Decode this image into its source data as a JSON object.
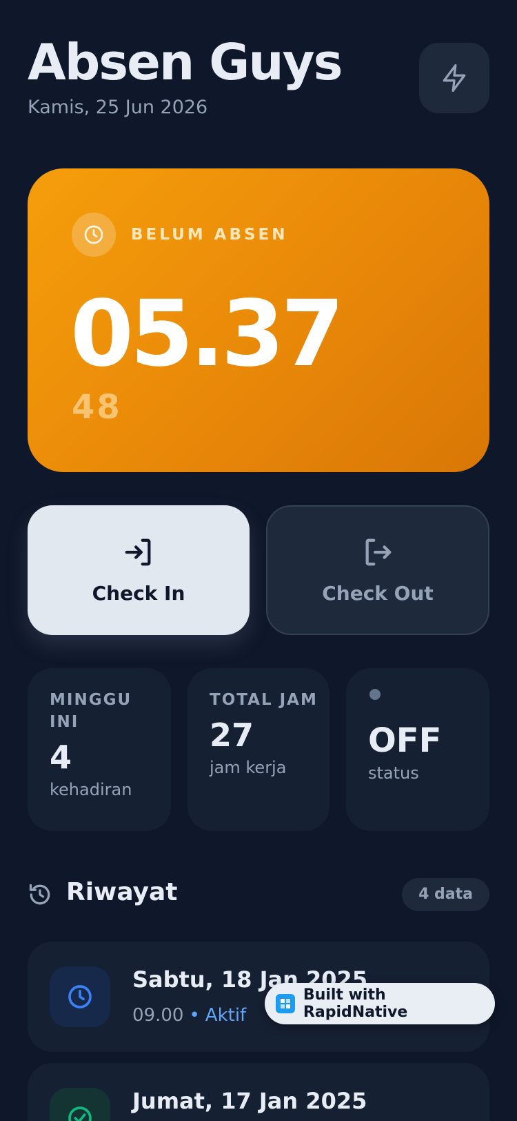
{
  "header": {
    "title": "Absen Guys",
    "date": "Kamis, 25 Jun 2026",
    "action_icon": "bolt-icon"
  },
  "hero": {
    "status": "BELUM ABSEN",
    "time": "05.37",
    "seconds": "48",
    "gradient_start": "#f59e0b",
    "gradient_end": "#d97706",
    "icon": "clock-icon"
  },
  "actions": {
    "check_in": {
      "label": "Check In",
      "icon": "login-icon"
    },
    "check_out": {
      "label": "Check Out",
      "icon": "logout-icon"
    }
  },
  "stats": [
    {
      "label": "MINGGU INI",
      "value": "4",
      "sub": "kehadiran"
    },
    {
      "label": "TOTAL JAM",
      "value": "27",
      "sub": "jam kerja"
    },
    {
      "label": "",
      "value": "OFF",
      "sub": "status",
      "indicator_color": "#64748b"
    }
  ],
  "history": {
    "title": "Riwayat",
    "count_badge": "4 data",
    "items": [
      {
        "date": "Sabtu, 18 Jan 2025",
        "time": "09.00",
        "separator": "•",
        "status": "Aktif",
        "icon": "clock-icon",
        "accent": "#3b82f6"
      },
      {
        "date": "Jumat, 17 Jan 2025",
        "icon": "check-circle-icon",
        "accent": "#10b981"
      }
    ]
  },
  "watermark": {
    "label": "Built with RapidNative"
  },
  "colors": {
    "background": "#0f172a",
    "card": "#162033",
    "accent_blue": "#60a5fa"
  }
}
